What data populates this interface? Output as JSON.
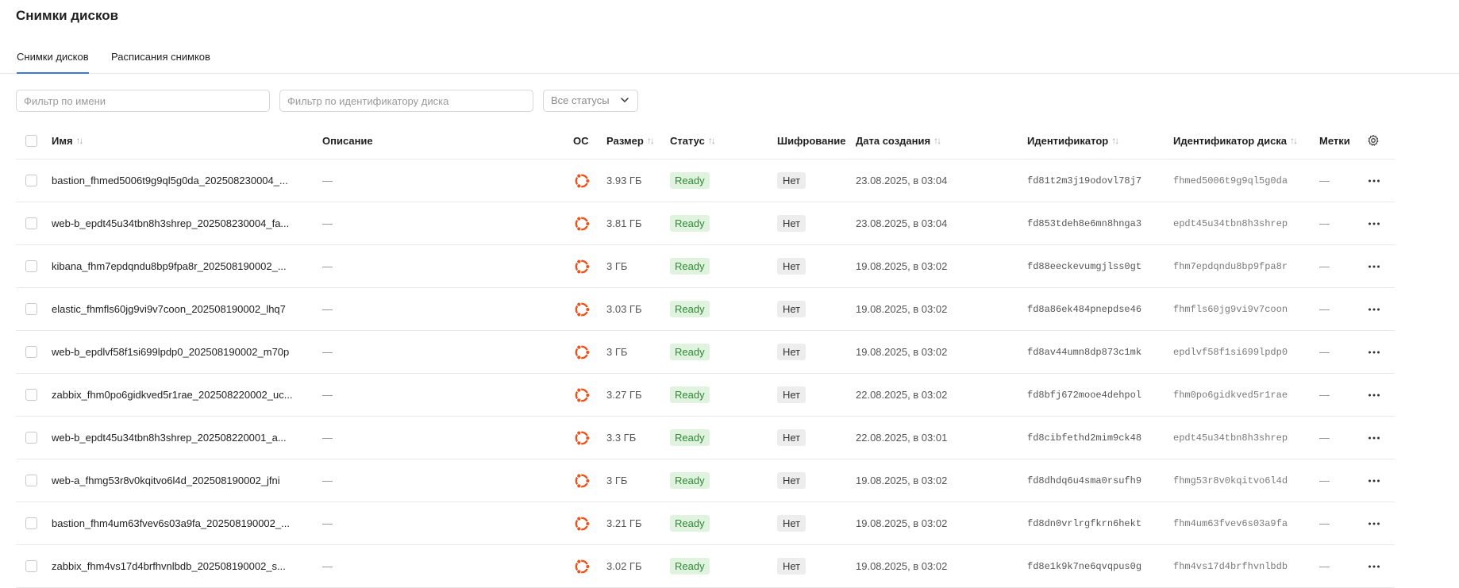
{
  "page": {
    "title": "Снимки дисков"
  },
  "tabs": [
    {
      "label": "Снимки дисков",
      "active": true
    },
    {
      "label": "Расписания снимков",
      "active": false
    }
  ],
  "filters": {
    "name_placeholder": "Фильтр по имени",
    "disk_placeholder": "Фильтр по идентификатору диска",
    "status_value": "Все статусы"
  },
  "columns": {
    "name": "Имя",
    "description": "Описание",
    "os": "ОС",
    "size": "Размер",
    "status": "Статус",
    "encryption": "Шифрование",
    "created": "Дата создания",
    "id": "Идентификатор",
    "disk_id": "Идентификатор диска",
    "labels": "Метки"
  },
  "sort_glyph": "↑↓",
  "icons": {
    "os": "ubuntu-icon",
    "settings": "gear-icon",
    "menu": "more-horizontal-icon",
    "chevron": "chevron-down-icon"
  },
  "colors": {
    "accent": "#3d7ad6",
    "ubuntu": "#e95420",
    "ready_bg": "#dff3df",
    "ready_text": "#2e8a33"
  },
  "rows": [
    {
      "name": "bastion_fhmed5006t9g9ql5g0da_202508230004_...",
      "description": "—",
      "size": "3.93 ГБ",
      "status": "Ready",
      "encryption": "Нет",
      "created": "23.08.2025, в 03:04",
      "id": "fd81t2m3j19odovl78j7",
      "disk_id": "fhmed5006t9g9ql5g0da",
      "labels": "—"
    },
    {
      "name": "web-b_epdt45u34tbn8h3shrep_202508230004_fa...",
      "description": "—",
      "size": "3.81 ГБ",
      "status": "Ready",
      "encryption": "Нет",
      "created": "23.08.2025, в 03:04",
      "id": "fd853tdeh8e6mn8hnga3",
      "disk_id": "epdt45u34tbn8h3shrep",
      "labels": "—"
    },
    {
      "name": "kibana_fhm7epdqndu8bp9fpa8r_202508190002_...",
      "description": "—",
      "size": "3 ГБ",
      "status": "Ready",
      "encryption": "Нет",
      "created": "19.08.2025, в 03:02",
      "id": "fd88eeckevumgjlss0gt",
      "disk_id": "fhm7epdqndu8bp9fpa8r",
      "labels": "—"
    },
    {
      "name": "elastic_fhmfls60jg9vi9v7coon_202508190002_lhq7",
      "description": "—",
      "size": "3.03 ГБ",
      "status": "Ready",
      "encryption": "Нет",
      "created": "19.08.2025, в 03:02",
      "id": "fd8a86ek484pnepdse46",
      "disk_id": "fhmfls60jg9vi9v7coon",
      "labels": "—"
    },
    {
      "name": "web-b_epdlvf58f1si699lpdp0_202508190002_m70p",
      "description": "—",
      "size": "3 ГБ",
      "status": "Ready",
      "encryption": "Нет",
      "created": "19.08.2025, в 03:02",
      "id": "fd8av44umn8dp873c1mk",
      "disk_id": "epdlvf58f1si699lpdp0",
      "labels": "—"
    },
    {
      "name": "zabbix_fhm0po6gidkved5r1rae_202508220002_uc...",
      "description": "—",
      "size": "3.27 ГБ",
      "status": "Ready",
      "encryption": "Нет",
      "created": "22.08.2025, в 03:02",
      "id": "fd8bfj672mooe4dehpol",
      "disk_id": "fhm0po6gidkved5r1rae",
      "labels": "—"
    },
    {
      "name": "web-b_epdt45u34tbn8h3shrep_202508220001_a...",
      "description": "—",
      "size": "3.3 ГБ",
      "status": "Ready",
      "encryption": "Нет",
      "created": "22.08.2025, в 03:01",
      "id": "fd8cibfethd2mim9ck48",
      "disk_id": "epdt45u34tbn8h3shrep",
      "labels": "—"
    },
    {
      "name": "web-a_fhmg53r8v0kqitvo6l4d_202508190002_jfni",
      "description": "—",
      "size": "3 ГБ",
      "status": "Ready",
      "encryption": "Нет",
      "created": "19.08.2025, в 03:02",
      "id": "fd8dhdq6u4sma0rsufh9",
      "disk_id": "fhmg53r8v0kqitvo6l4d",
      "labels": "—"
    },
    {
      "name": "bastion_fhm4um63fvev6s03a9fa_202508190002_...",
      "description": "—",
      "size": "3.21 ГБ",
      "status": "Ready",
      "encryption": "Нет",
      "created": "19.08.2025, в 03:02",
      "id": "fd8dn0vrlrgfkrn6hekt",
      "disk_id": "fhm4um63fvev6s03a9fa",
      "labels": "—"
    },
    {
      "name": "zabbix_fhm4vs17d4brfhvnlbdb_202508190002_s...",
      "description": "—",
      "size": "3.02 ГБ",
      "status": "Ready",
      "encryption": "Нет",
      "created": "19.08.2025, в 03:02",
      "id": "fd8e1k9k7ne6qvqpus0g",
      "disk_id": "fhm4vs17d4brfhvnlbdb",
      "labels": "—"
    }
  ]
}
